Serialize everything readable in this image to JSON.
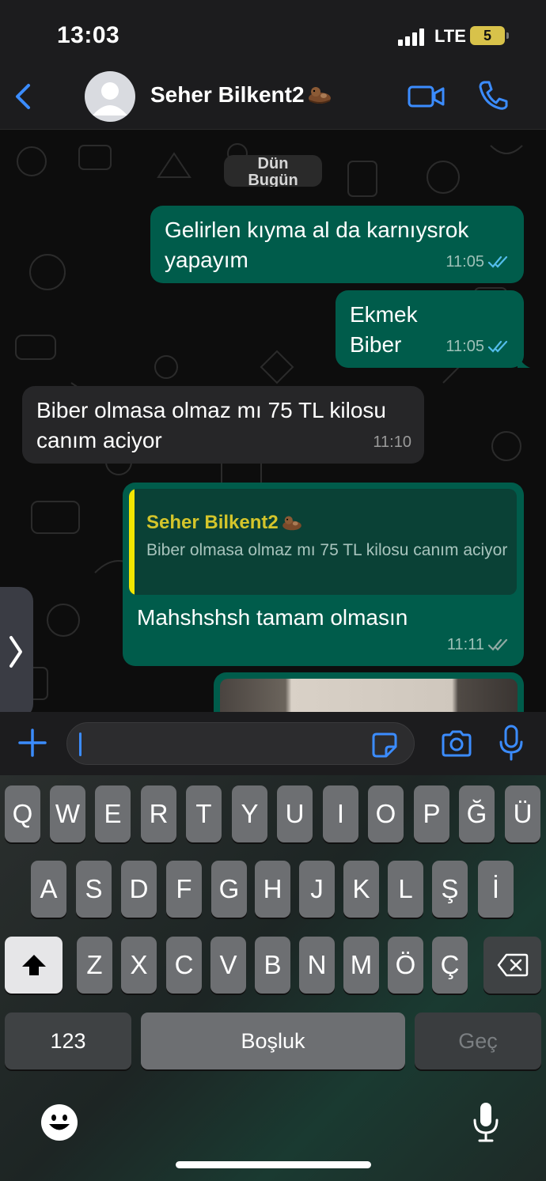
{
  "status_bar": {
    "time": "13:03",
    "network": "LTE",
    "battery": "5"
  },
  "header": {
    "contact_name": "Seher Bilkent2"
  },
  "chat": {
    "date_labels": [
      "Dün",
      "Bugün"
    ],
    "messages": [
      {
        "direction": "outgoing",
        "text": "Gelirlen kıyma al da karnıysrok\nyapayım",
        "time": "11:05",
        "status": "read"
      },
      {
        "direction": "outgoing",
        "text": "Ekmek\nBiber",
        "time": "11:05",
        "status": "read"
      },
      {
        "direction": "incoming",
        "text": "Biber olmasa olmaz mı 75 TL kilosu\ncanım aciyor",
        "time": "11:10"
      },
      {
        "direction": "outgoing",
        "quote_author": "Seher Bilkent2",
        "quote_text": "Biber olmasa olmaz mı 75 TL kilosu canım aciyor",
        "text": "Mahshshsh tamam olmasın",
        "time": "11:11",
        "status": "delivered"
      }
    ]
  },
  "keyboard": {
    "row1": [
      "Q",
      "W",
      "E",
      "R",
      "T",
      "Y",
      "U",
      "I",
      "O",
      "P",
      "Ğ",
      "Ü"
    ],
    "row2": [
      "A",
      "S",
      "D",
      "F",
      "G",
      "H",
      "J",
      "K",
      "L",
      "Ş",
      "İ"
    ],
    "row3": [
      "Z",
      "X",
      "C",
      "V",
      "B",
      "N",
      "M",
      "Ö",
      "Ç"
    ],
    "numbers_label": "123",
    "space_label": "Boşluk",
    "return_label": "Geç"
  },
  "colors": {
    "accent": "#3b8cff",
    "outgoing_bubble": "#005c4b",
    "incoming_bubble": "#262628",
    "read_ticks": "#53bdeb",
    "quote_bar": "#f2e600"
  },
  "icons": [
    "back-icon",
    "avatar",
    "otter-emoji",
    "video-call-icon",
    "phone-icon",
    "plus-icon",
    "sticker-icon",
    "camera-icon",
    "mic-icon",
    "emoji-icon",
    "shift-icon",
    "backspace-icon"
  ]
}
